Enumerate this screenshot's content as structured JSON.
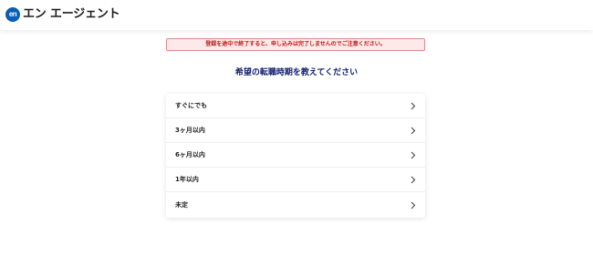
{
  "header": {
    "logo_mark": "en",
    "logo_text": "エン エージェント"
  },
  "warning": {
    "text": "登録を途中で終了すると、申し込みは完了しませんのでご注意ください。"
  },
  "question": {
    "title": "希望の転職時期を教えてください"
  },
  "options": [
    {
      "label": "すぐにでも",
      "icon": "chevron-right-icon"
    },
    {
      "label": "3ヶ月以内",
      "icon": "chevron-right-icon"
    },
    {
      "label": "6ヶ月以内",
      "icon": "chevron-right-icon"
    },
    {
      "label": "1年以内",
      "icon": "chevron-right-icon"
    },
    {
      "label": "未定",
      "icon": "chevron-right-icon"
    }
  ],
  "colors": {
    "brand": "#0a5fb4",
    "question_text": "#12206b",
    "warning_text": "#c81414",
    "warning_bg": "#fde9e9",
    "warning_border": "#e08a8a"
  }
}
